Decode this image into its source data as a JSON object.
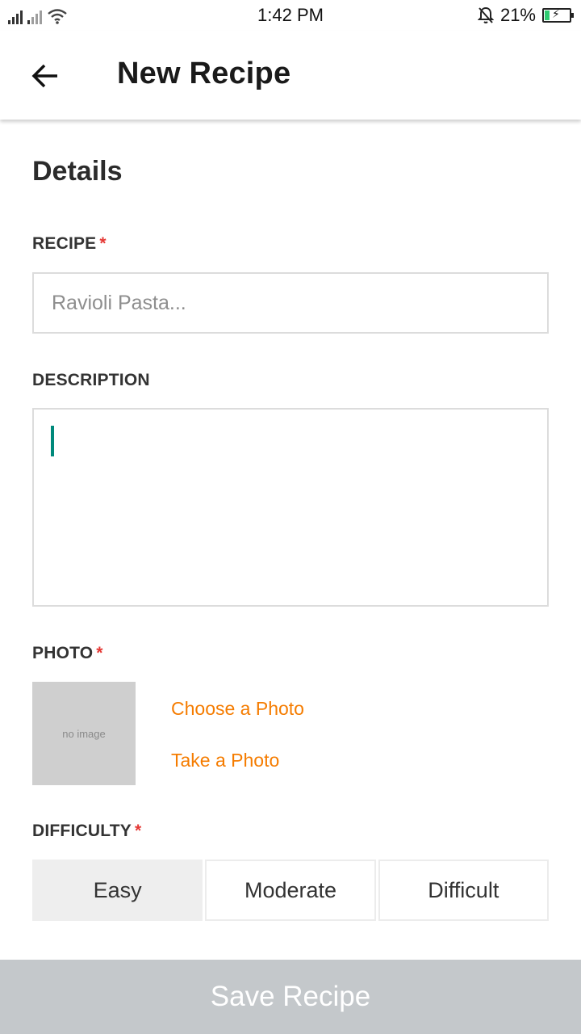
{
  "status_bar": {
    "time": "1:42 PM",
    "battery_percent": "21%",
    "battery_level": 0.21,
    "colors": {
      "battery_fill": "#2ecc71"
    },
    "icons": [
      "signal-icon",
      "wifi-icon",
      "mute-bell-icon",
      "battery-icon"
    ]
  },
  "app_bar": {
    "title": "New Recipe",
    "back_icon": "arrow-left-icon"
  },
  "form": {
    "section_title": "Details",
    "recipe": {
      "label": "RECIPE",
      "required_mark": "*",
      "placeholder": "Ravioli Pasta...",
      "value": ""
    },
    "description": {
      "label": "DESCRIPTION",
      "value": ""
    },
    "photo": {
      "label": "PHOTO",
      "required_mark": "*",
      "placeholder_text": "no image",
      "choose_label": "Choose a Photo",
      "take_label": "Take a Photo"
    },
    "difficulty": {
      "label": "DIFFICULTY",
      "required_mark": "*",
      "options": [
        "Easy",
        "Moderate",
        "Difficult"
      ],
      "selected": "Easy"
    }
  },
  "save_button": {
    "label": "Save Recipe"
  },
  "colors": {
    "accent": "#f57c00",
    "required": "#e53935",
    "caret": "#00897b",
    "save_disabled": "#c4c8cb"
  }
}
